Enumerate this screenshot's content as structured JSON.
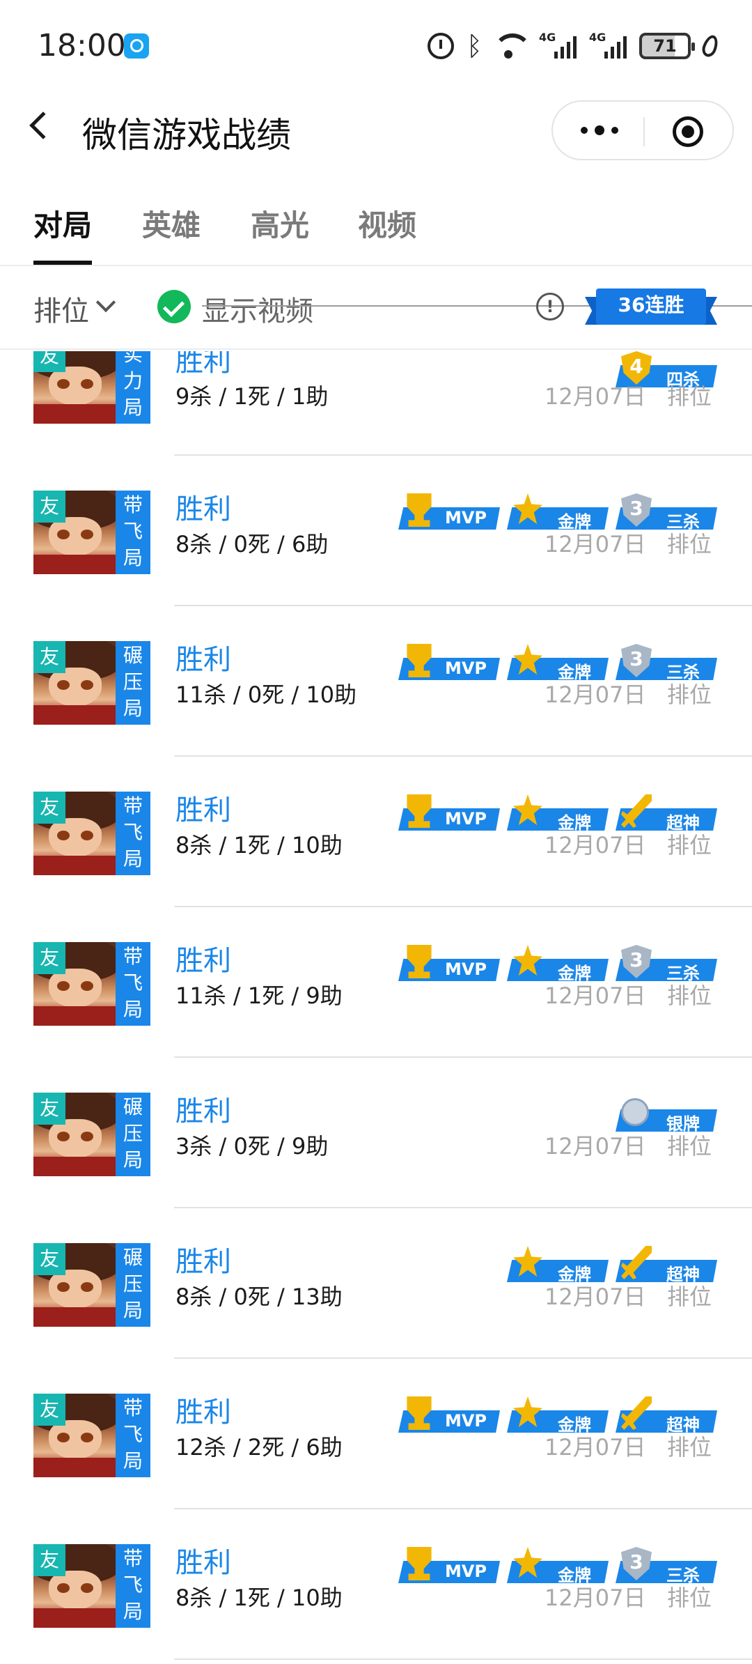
{
  "status_bar": {
    "time": "18:00",
    "battery": "71",
    "icons": [
      "app-notification-icon",
      "alarm-icon",
      "bluetooth-icon",
      "wifi-icon",
      "signal-4g-icon",
      "signal-4g-icon",
      "battery-icon",
      "leaf-icon"
    ],
    "signal_label": "4G"
  },
  "title_bar": {
    "title": "微信游戏战绩"
  },
  "tabs": [
    {
      "label": "对局",
      "active": true
    },
    {
      "label": "英雄",
      "active": false
    },
    {
      "label": "高光",
      "active": false
    },
    {
      "label": "视频",
      "active": false
    }
  ],
  "filter": {
    "rank_label": "排位",
    "show_video_label": "显示视频",
    "streak_label": "36连胜"
  },
  "badge_labels": {
    "mvp": "MVP",
    "gold": "金牌",
    "silver": "银牌",
    "triple": "三杀",
    "quadra": "四杀",
    "legendary": "超神"
  },
  "matches": [
    {
      "friend": "友",
      "mode_tag": "实力局",
      "result": "胜利",
      "kda": "9杀 / 1死 / 1助",
      "date": "12月07日",
      "mode": "排位",
      "badges": [
        "quadra"
      ]
    },
    {
      "friend": "友",
      "mode_tag": "带飞局",
      "result": "胜利",
      "kda": "8杀 / 0死 / 6助",
      "date": "12月07日",
      "mode": "排位",
      "badges": [
        "mvp",
        "gold",
        "triple"
      ]
    },
    {
      "friend": "友",
      "mode_tag": "碾压局",
      "result": "胜利",
      "kda": "11杀 / 0死 / 10助",
      "date": "12月07日",
      "mode": "排位",
      "badges": [
        "mvp",
        "gold",
        "triple"
      ]
    },
    {
      "friend": "友",
      "mode_tag": "带飞局",
      "result": "胜利",
      "kda": "8杀 / 1死 / 10助",
      "date": "12月07日",
      "mode": "排位",
      "badges": [
        "mvp",
        "gold",
        "legendary"
      ]
    },
    {
      "friend": "友",
      "mode_tag": "带飞局",
      "result": "胜利",
      "kda": "11杀 / 1死 / 9助",
      "date": "12月07日",
      "mode": "排位",
      "badges": [
        "mvp",
        "gold",
        "triple"
      ]
    },
    {
      "friend": "友",
      "mode_tag": "碾压局",
      "result": "胜利",
      "kda": "3杀 / 0死 / 9助",
      "date": "12月07日",
      "mode": "排位",
      "badges": [
        "silver"
      ]
    },
    {
      "friend": "友",
      "mode_tag": "碾压局",
      "result": "胜利",
      "kda": "8杀 / 0死 / 13助",
      "date": "12月07日",
      "mode": "排位",
      "badges": [
        "gold",
        "legendary"
      ]
    },
    {
      "friend": "友",
      "mode_tag": "带飞局",
      "result": "胜利",
      "kda": "12杀 / 2死 / 6助",
      "date": "12月07日",
      "mode": "排位",
      "badges": [
        "mvp",
        "gold",
        "legendary"
      ]
    },
    {
      "friend": "友",
      "mode_tag": "带飞局",
      "result": "胜利",
      "kda": "8杀 / 1死 / 10助",
      "date": "12月07日",
      "mode": "排位",
      "badges": [
        "mvp",
        "gold",
        "triple"
      ]
    }
  ]
}
